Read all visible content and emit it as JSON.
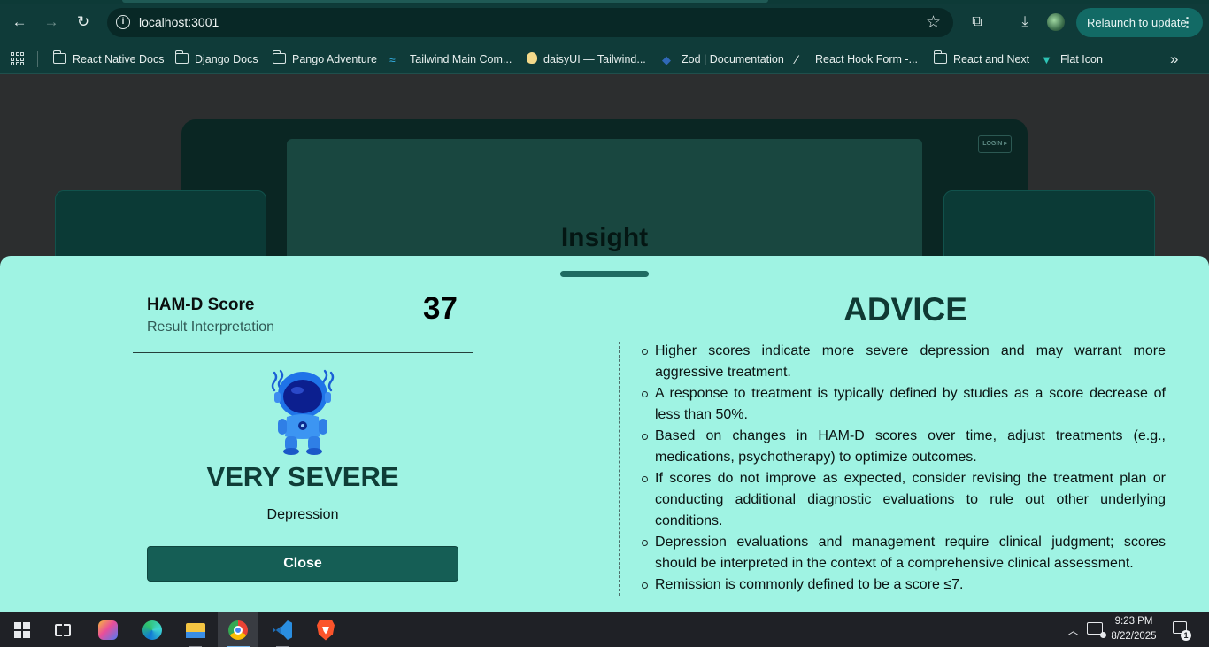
{
  "browser": {
    "url": "localhost:3001",
    "relaunch_label": "Relaunch to update",
    "bookmarks": [
      {
        "label": "React Native Docs",
        "icon": "folder-icon"
      },
      {
        "label": "Django Docs",
        "icon": "folder-icon"
      },
      {
        "label": "Pango Adventure",
        "icon": "folder-icon"
      },
      {
        "label": "Tailwind Main Com...",
        "icon": "tailwind-icon"
      },
      {
        "label": "daisyUI — Tailwind...",
        "icon": "daisyui-icon"
      },
      {
        "label": "Zod | Documentation",
        "icon": "zod-icon"
      },
      {
        "label": "React Hook Form -...",
        "icon": "react-hook-form-icon"
      },
      {
        "label": "React and Next",
        "icon": "folder-icon"
      },
      {
        "label": "Flat Icon",
        "icon": "flaticon-icon"
      }
    ]
  },
  "background_page": {
    "title": "Insight",
    "login_label": "LOGIN ▸"
  },
  "result": {
    "score_heading": "HAM-D Score",
    "score_subheading": "Result Interpretation",
    "score_value": "37",
    "severity": "VERY SEVERE",
    "condition": "Depression",
    "close_label": "Close"
  },
  "advice": {
    "title": "ADVICE",
    "items": [
      "Higher scores indicate more severe depression and may warrant more aggressive treatment.",
      "A response to treatment is typically defined by studies as a score decrease of less than 50%.",
      "Based on changes in HAM-D scores over time, adjust treatments (e.g., medications, psychotherapy) to optimize outcomes.",
      "If scores do not improve as expected, consider revising the treatment plan or conducting additional diagnostic evaluations to rule out other underlying conditions.",
      "Depression evaluations and management require clinical judgment; scores should be interpreted in the context of a comprehensive clinical assessment.",
      "Remission is commonly defined to be a score ≤7."
    ]
  },
  "taskbar": {
    "time": "9:23 PM",
    "date": "8/22/2025",
    "notification_count": "1"
  },
  "colors": {
    "sheet_background": "#9ff3e3",
    "accent": "#155e55",
    "browser_chrome": "#0f3b39"
  }
}
